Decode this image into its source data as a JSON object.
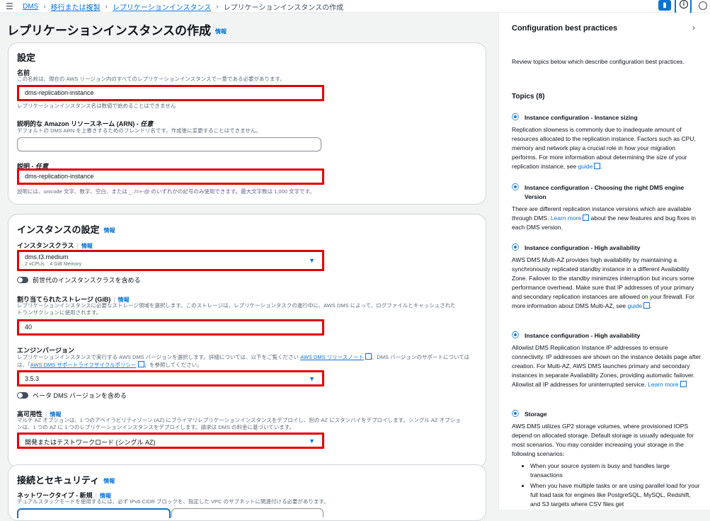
{
  "breadcrumb": [
    "DMS",
    "移行または複製",
    "レプリケーションインスタンス",
    "レプリケーションインスタンスの作成"
  ],
  "page": {
    "title": "レプリケーションインスタンスの作成",
    "info": "情報"
  },
  "settings": {
    "title": "設定",
    "name_label": "名前",
    "name_desc": "この名前は、現在の AWS リージョン内のすべてのレプリケーションインスタンスで一意である必要があります。",
    "name_value": "dms-replication-instance",
    "name_hint": "レプリケーションインスタンス名は数値で始めることはできません",
    "arn_label": "説明的な Amazon リソースネーム (ARN) - ",
    "arn_optional": "任意",
    "arn_desc": "デフォルトの DMS ARN を上書きするためのフレンドリ名です。作成後に変更することはできません。",
    "arn_value": "",
    "desc_label": "説明 - ",
    "desc_optional": "任意",
    "desc_value": "dms-replication-instance",
    "desc_hint": "説明には、unicode 文字、数字、空白、または _.:/=+-@ のいずれかの記号のみ使用できます。最大文字数は 1,000 文字です。"
  },
  "instance": {
    "title": "インスタンスの設定",
    "info": "情報",
    "class_label": "インスタンスクラス",
    "class_value": "dms.t3.medium",
    "class_vcpu": "2 vCPUs",
    "class_mem": "4 GiB Memory",
    "prev_gen_toggle": "前世代のインスタンスクラスを含める",
    "storage_label": "割り当てられたストレージ (GiB)",
    "storage_desc1": "レプリケーションインスタンスに必要なストレージ領域を選択します。このストレージは、レプリケーションタスクの進行中に、AWS DMS によって、ログファイルとキャッシュされた",
    "storage_desc2": "トランザクションに使用されます。",
    "storage_value": "40",
    "engine_label": "エンジンバージョン",
    "engine_desc1a": "レプリケーションインスタンスで実行する AWS DMS バージョンを選択します。詳細については、以下をご覧ください ",
    "engine_link1": "AWS DMS リリースノート",
    "engine_desc1b": "。DMS バージョンのサポートについては",
    "engine_desc2a": "は、「",
    "engine_link2": "AWS DMS サポートライフサイクルポリシー",
    "engine_desc2b": "」を参照してください。",
    "engine_value": "3.5.3",
    "beta_toggle": "ベータ DMS バージョンを含める",
    "ha_label": "高可用性",
    "ha_desc1": "マルチ AZ オプションは、1 つのアベイラビリティゾーン (AZ) にプライマリレプリケーションインスタンスをデプロイし、別の AZ にスタンバイをデプロイします。シングル AZ オプショ",
    "ha_desc2": "ンは、1 つの AZ に 1 つのレプリケーションインスタンスをデプロイします。請求は DMS の料金に基づいています。",
    "ha_value": "開発またはテストワークロード (シングル AZ)"
  },
  "connectivity": {
    "title": "接続とセキュリティ",
    "info": "情報",
    "network_label": "ネットワークタイプ - 新規",
    "network_desc": "デュアルスタックモードを使用するには、必ず IPv6 CIDR ブロックを、指定した VPC のサブネットに関連付ける必要があります。"
  },
  "side": {
    "title": "Configuration best practices",
    "intro": "Review topics below which describe configuration best practices.",
    "topics_heading": "Topics (8)",
    "topics": [
      {
        "title": "Instance configuration - Instance sizing",
        "body": "Replication slowness is commonly due to inadequate amount of resources allocated to the replication instance. Factors such as CPU, memory and network play a crucial role in how your migration performs. For more information about determining the size of your replication instance, see ",
        "link": "guide",
        "tail": "."
      },
      {
        "title": "Instance configuration - Choosing the right DMS engine Version",
        "body": "There are different replication instance versions which are available through DMS. ",
        "link": "Learn more",
        "tail": " about the new features and bug fixes in each DMS version."
      },
      {
        "title": "Instance configuration - High availability",
        "body": "AWS DMS Multi-AZ provides high availability by maintaining a synchronously replicated standby instance in a different Availability Zone. Failover to the standby minimizes interruption but incurs some performance overhead. Make sure that IP addresses of your primary and secondary replication instances are allowed on your firewall. For more information about DMS Multi-AZ, see ",
        "link": "guide",
        "tail": "."
      },
      {
        "title": "Instance configuration - High availability",
        "body": "Allowlist DMS Replication Instance IP addresses to ensure connectivity. IP addresses are shown on the instance details page after creation. For Multi-AZ, AWS DMS launches primary and secondary instances in separate Availability Zones, providing automatic failover. Allowlist all IP addresses for uninterrupted service. ",
        "link": "Learn more",
        "tail": ""
      },
      {
        "title": "Storage",
        "body": "AWS DMS utilizes GP2 storage volumes, where provisioned IOPS depend on allocated storage. Default storage is usually adequate for most scenarios. You may consider increasing your storage in the following scenarios:",
        "bullets": [
          "When your source system is busy and handles large transactions",
          "When you have multiple tasks or are using parallel load for your full load task for engines like PostgreSQL, MySQL, Redshift, and S3 targets where CSV files get"
        ]
      }
    ]
  },
  "colors": {
    "accent": "#0972d3",
    "highlight": "#e10000"
  }
}
